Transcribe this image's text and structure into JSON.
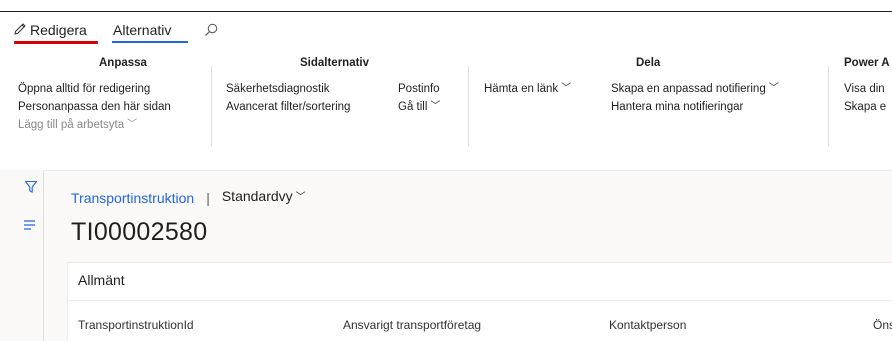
{
  "ribbon": {
    "tabs": [
      {
        "label": "Redigera",
        "icon": "pencil-icon",
        "accent": "#d50000"
      },
      {
        "label": "Alternativ",
        "accent": "#2266e3"
      }
    ],
    "search_icon": "search-icon",
    "groups": [
      {
        "title": "Anpassa",
        "commands": [
          {
            "label": "Öppna alltid för redigering"
          },
          {
            "label": "Personanpassa den här sidan"
          },
          {
            "label": "Lägg till på arbetsyta",
            "dropdown": "chevron-down-icon",
            "disabled": true
          }
        ]
      },
      {
        "title": "Sidalternativ",
        "commands": [
          {
            "label": "Säkerhetsdiagnostik"
          },
          {
            "label": "Avancerat filter/sortering"
          },
          {
            "label": "Postinfo"
          },
          {
            "label": "Gå till",
            "dropdown": "chevron-down-icon"
          }
        ]
      },
      {
        "title": "",
        "commands": [
          {
            "label": "Hämta en länk",
            "dropdown": "chevron-down-icon"
          }
        ]
      },
      {
        "title": "Dela",
        "commands": [
          {
            "label": "Skapa en anpassad notifiering",
            "dropdown": "chevron-down-icon"
          },
          {
            "label": "Hantera mina notifieringar"
          }
        ]
      },
      {
        "title": "Power A",
        "commands": [
          {
            "label": "Visa din"
          },
          {
            "label": "Skapa e"
          }
        ]
      }
    ]
  },
  "rail": {
    "icons": [
      "filter-icon",
      "lines-icon"
    ]
  },
  "breadcrumb": {
    "link": "Transportinstruktion",
    "separator": "|",
    "view": "Standardvy"
  },
  "page_title": "TI00002580",
  "section": {
    "title": "Allmänt",
    "fields": [
      "TransportinstruktionId",
      "Ansvarigt transportföretag",
      "Kontaktperson",
      "Öns"
    ]
  },
  "colors": {
    "link": "#2266e3",
    "edit_underline": "#d50000",
    "alt_underline": "#2266e3"
  }
}
